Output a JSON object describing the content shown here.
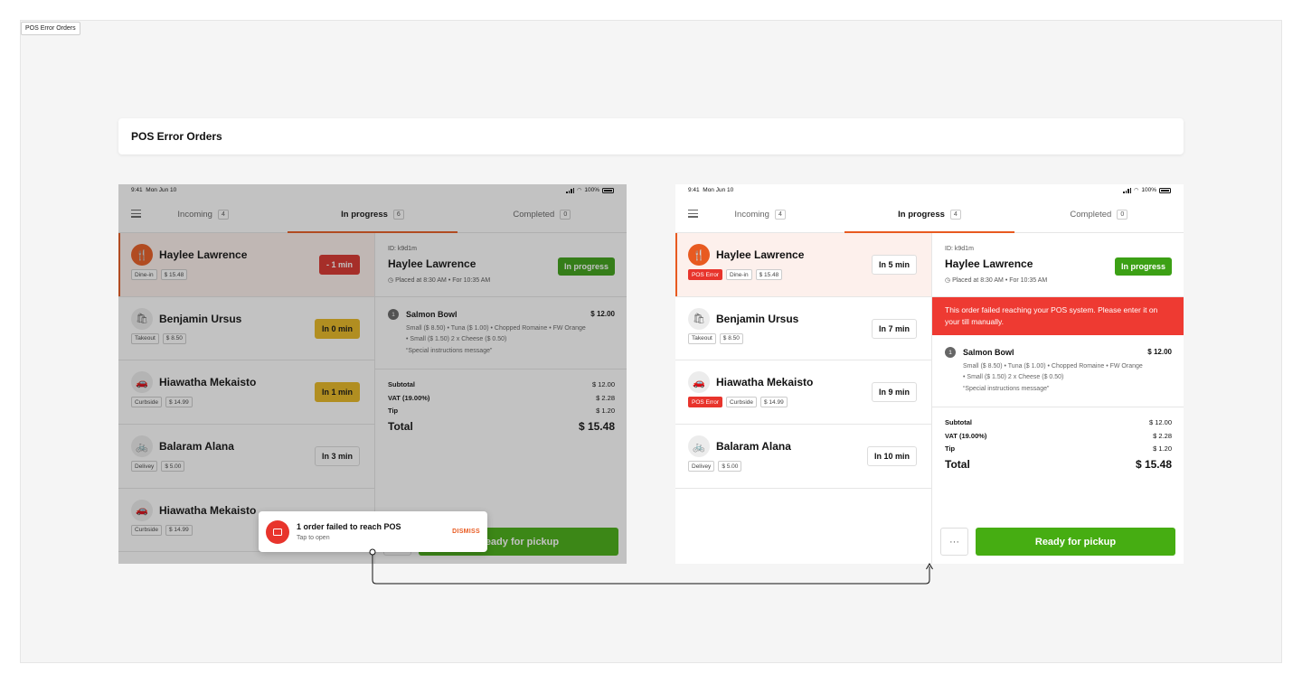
{
  "page_tag": "POS Error Orders",
  "header": {
    "title": "POS Error Orders"
  },
  "status_bar": {
    "time": "9:41",
    "date": "Mon Jun 10",
    "battery": "100%"
  },
  "left_screen": {
    "tabs": [
      {
        "label": "Incoming",
        "count": "4"
      },
      {
        "label": "In progress",
        "count": "6"
      },
      {
        "label": "Completed",
        "count": "0"
      }
    ],
    "orders": [
      {
        "name": "Haylee Lawrence",
        "icon": "fork-knife-icon",
        "tags": [
          "Dine-in",
          "$ 15.48"
        ],
        "time": "- 1 min"
      },
      {
        "name": "Benjamin Ursus",
        "icon": "takeout-bag-icon",
        "tags": [
          "Takeout",
          "$ 8.50"
        ],
        "time": "In 0 min"
      },
      {
        "name": "Hiawatha Mekaisto",
        "icon": "car-icon",
        "tags": [
          "Curbside",
          "$ 14.99"
        ],
        "time": "In 1 min"
      },
      {
        "name": "Balaram Alana",
        "icon": "bike-icon",
        "tags": [
          "Delivey",
          "$ 5.00"
        ],
        "time": "In 3 min"
      },
      {
        "name": "Hiawatha Mekaisto",
        "icon": "car-icon",
        "tags": [
          "Curbside",
          "$ 14.99"
        ],
        "time": ""
      }
    ]
  },
  "right_screen": {
    "tabs": [
      {
        "label": "Incoming",
        "count": "4"
      },
      {
        "label": "In progress",
        "count": "4"
      },
      {
        "label": "Completed",
        "count": "0"
      }
    ],
    "orders": [
      {
        "name": "Haylee Lawrence",
        "icon": "fork-knife-icon",
        "pos_error": "POS Error",
        "tags": [
          "Dine-in",
          "$ 15.48"
        ],
        "time": "In 5 min"
      },
      {
        "name": "Benjamin Ursus",
        "icon": "takeout-bag-icon",
        "tags": [
          "Takeout",
          "$ 8.50"
        ],
        "time": "In 7 min"
      },
      {
        "name": "Hiawatha Mekaisto",
        "icon": "car-icon",
        "pos_error": "POS Error",
        "tags": [
          "Curbside",
          "$ 14.99"
        ],
        "time": "In 9 min"
      },
      {
        "name": "Balaram Alana",
        "icon": "bike-icon",
        "tags": [
          "Delivey",
          "$ 5.00"
        ],
        "time": "In 10 min"
      }
    ],
    "alert": "This order failed reaching your POS system. Please enter it on your till manually."
  },
  "detail": {
    "id": "ID: k9d1m",
    "name": "Haylee Lawrence",
    "status": "In progress",
    "placed": "Placed at 8:30 AM • For 10:35 AM",
    "item": {
      "qty": "1",
      "name": "Salmon Bowl",
      "price": "$ 12.00",
      "modifiers": "Small ($ 8.50) • Tuna ($ 1.00) • Chopped Romaine • FW Orange • Small ($ 1.50) 2 x Cheese ($ 0.50)",
      "note": "“Special instructions message”"
    },
    "totals": {
      "subtotal_label": "Subtotal",
      "subtotal": "$ 12.00",
      "vat_label": "VAT (19.00%)",
      "vat": "$ 2.28",
      "tip_label": "Tip",
      "tip": "$ 1.20",
      "total_label": "Total",
      "total": "$ 15.48"
    },
    "more_label": "···",
    "ready_label": "Ready for pickup"
  },
  "toast": {
    "title": "1 order failed to reach POS",
    "subtitle": "Tap to open",
    "action": "DISMISS"
  }
}
